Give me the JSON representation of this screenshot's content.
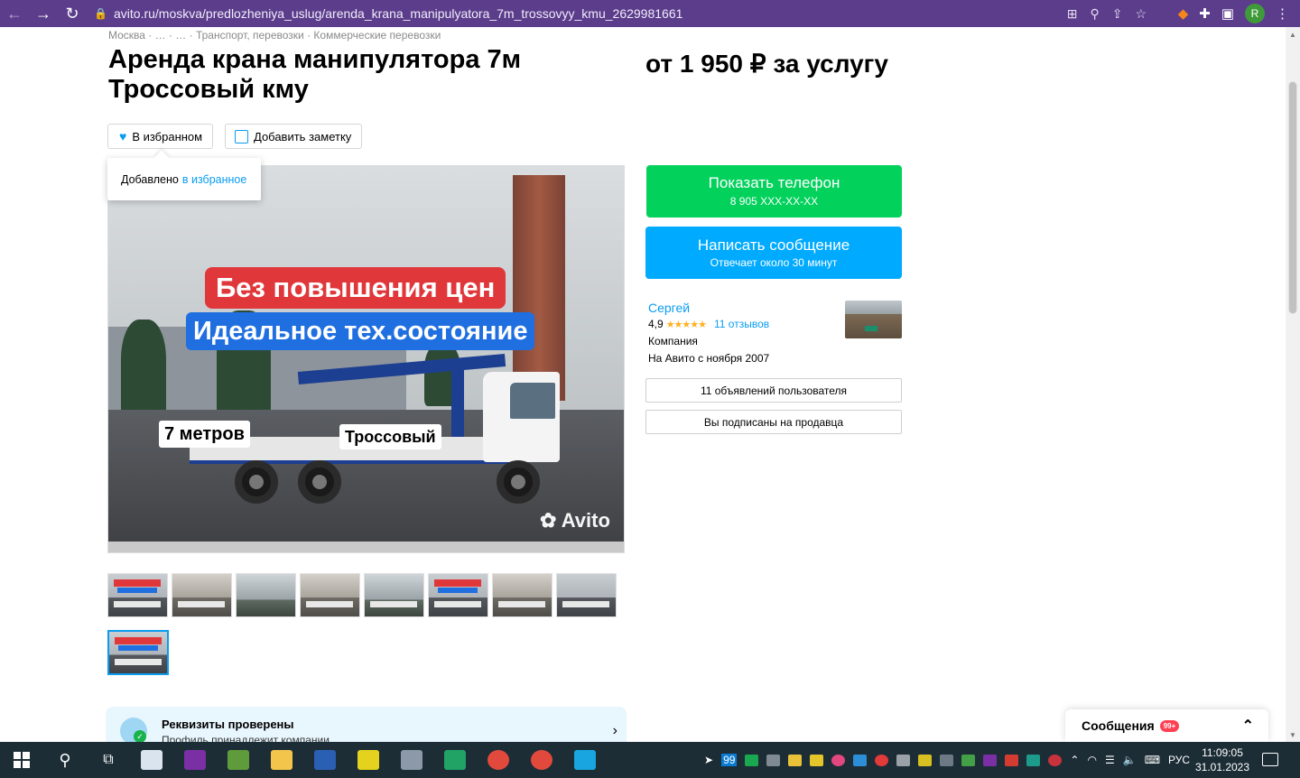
{
  "browser": {
    "url": "avito.ru/moskva/predlozheniya_uslug/arenda_krana_manipulyatora_7m_trossovyy_kmu_2629981661",
    "profile_initial": "R"
  },
  "breadcrumbs": "Москва · … · … · Транспорт, перевозки · Коммерческие перевозки",
  "listing": {
    "title": "Аренда крана манипулятора 7м Троссовый кму",
    "price": "от 1 950 ₽ за услугу"
  },
  "actions": {
    "favorite_label": "В избранном",
    "note_label": "Добавить заметку",
    "tooltip_text": "Добавлено",
    "tooltip_link": "в избранное"
  },
  "photo": {
    "banner_red": "Без повышения цен",
    "banner_blue": "Идеальное тех.состояние",
    "tag_length": "7 метров",
    "tag_type": "Тросcовый",
    "watermark": "Avito"
  },
  "thumbnails": [
    {
      "variant": "promo"
    },
    {
      "variant": "truck"
    },
    {
      "variant": "crane"
    },
    {
      "variant": "truck"
    },
    {
      "variant": "crane"
    },
    {
      "variant": "promo"
    },
    {
      "variant": "truck"
    },
    {
      "variant": "truck"
    },
    {
      "variant": "promo",
      "active": true
    }
  ],
  "contact": {
    "phone_label": "Показать телефон",
    "phone_masked": "8 905 XXX-XX-XX",
    "message_label": "Написать сообщение",
    "message_sub": "Отвечает около 30 минут"
  },
  "seller": {
    "name": "Сергей",
    "rating": "4,9",
    "stars": "★★★★★",
    "reviews": "11 отзывов",
    "type": "Компания",
    "since": "На Авито с ноября 2007",
    "ads_button": "11 объявлений пользователя",
    "subscribed_button": "Вы подписаны на продавца"
  },
  "verified": {
    "title": "Реквизиты проверены",
    "subtitle": "Профиль принадлежит компании"
  },
  "messages_widget": {
    "label": "Сообщения",
    "badge": "99+"
  },
  "taskbar": {
    "tray_count": "99",
    "language": "РУС",
    "time": "11:09:05",
    "date": "31.01.2023"
  },
  "colors": {
    "browser_frame": "#5b3d8c",
    "avito_blue": "#00aaff",
    "avito_green": "#02d15c",
    "link": "#0a9cf0"
  }
}
